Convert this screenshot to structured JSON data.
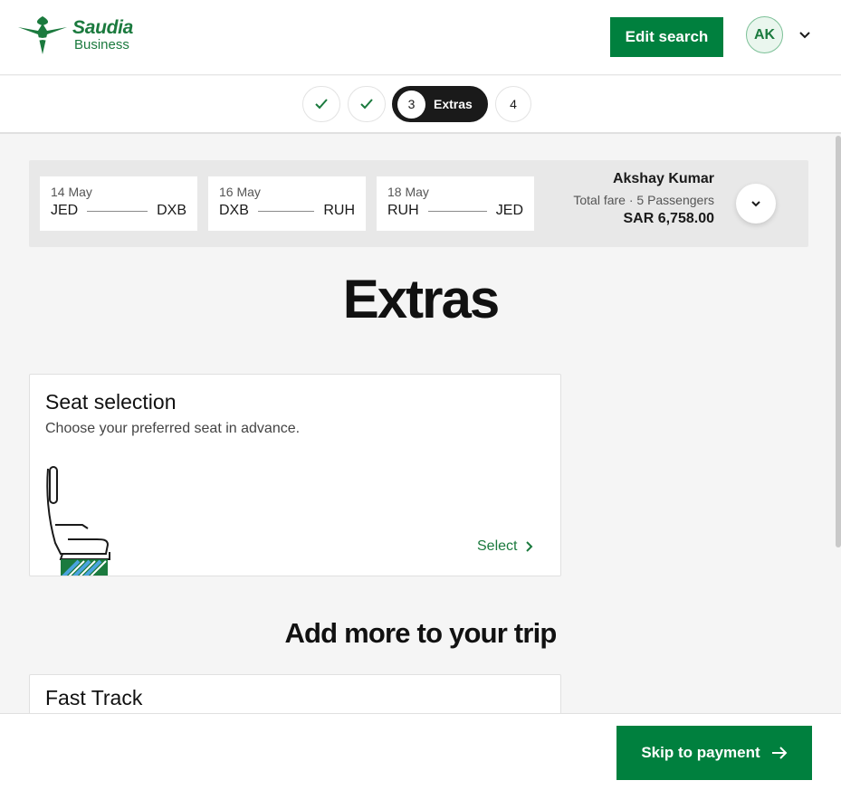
{
  "brand": {
    "name": "Saudia",
    "sub": "Business",
    "color": "#1b7a3e"
  },
  "header": {
    "edit_search": "Edit search",
    "user_initials": "AK"
  },
  "stepper": {
    "steps": [
      {
        "state": "done",
        "icon": "check-icon"
      },
      {
        "state": "done",
        "icon": "check-icon"
      },
      {
        "state": "active",
        "number": "3",
        "label": "Extras"
      },
      {
        "state": "todo",
        "number": "4"
      }
    ]
  },
  "summary": {
    "legs": [
      {
        "date": "14 May",
        "from": "JED",
        "to": "DXB"
      },
      {
        "date": "16 May",
        "from": "DXB",
        "to": "RUH"
      },
      {
        "date": "18 May",
        "from": "RUH",
        "to": "JED"
      }
    ],
    "passenger_name": "Akshay Kumar",
    "fare_label": "Total fare · 5 Passengers",
    "price": "SAR 6,758.00"
  },
  "page_title": "Extras",
  "seat_card": {
    "title": "Seat selection",
    "description": "Choose your preferred seat in advance.",
    "action": "Select"
  },
  "more_section": {
    "title": "Add more to your trip",
    "fast_track_title": "Fast Track"
  },
  "footer": {
    "skip_label": "Skip to payment"
  },
  "colors": {
    "accent": "#00803e",
    "dark": "#1a1a1a"
  }
}
